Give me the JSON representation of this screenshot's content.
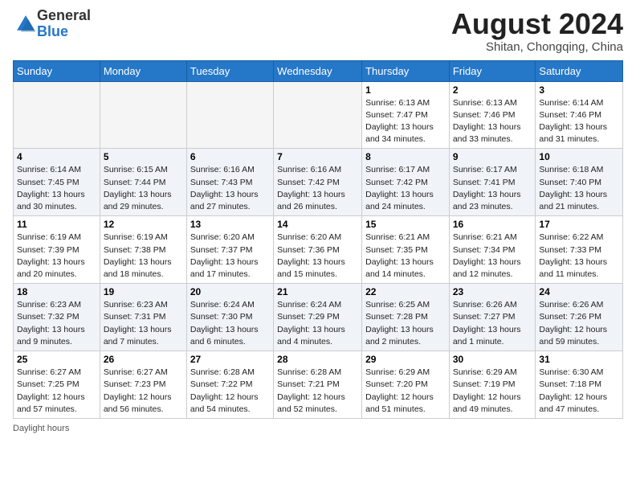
{
  "logo": {
    "general": "General",
    "blue": "Blue"
  },
  "title": "August 2024",
  "location": "Shitan, Chongqing, China",
  "days_of_week": [
    "Sunday",
    "Monday",
    "Tuesday",
    "Wednesday",
    "Thursday",
    "Friday",
    "Saturday"
  ],
  "footer": "Daylight hours",
  "weeks": [
    [
      {
        "day": "",
        "empty": true
      },
      {
        "day": "",
        "empty": true
      },
      {
        "day": "",
        "empty": true
      },
      {
        "day": "",
        "empty": true
      },
      {
        "day": "1",
        "sunrise": "6:13 AM",
        "sunset": "7:47 PM",
        "daylight": "13 hours and 34 minutes."
      },
      {
        "day": "2",
        "sunrise": "6:13 AM",
        "sunset": "7:46 PM",
        "daylight": "13 hours and 33 minutes."
      },
      {
        "day": "3",
        "sunrise": "6:14 AM",
        "sunset": "7:46 PM",
        "daylight": "13 hours and 31 minutes."
      }
    ],
    [
      {
        "day": "4",
        "sunrise": "6:14 AM",
        "sunset": "7:45 PM",
        "daylight": "13 hours and 30 minutes."
      },
      {
        "day": "5",
        "sunrise": "6:15 AM",
        "sunset": "7:44 PM",
        "daylight": "13 hours and 29 minutes."
      },
      {
        "day": "6",
        "sunrise": "6:16 AM",
        "sunset": "7:43 PM",
        "daylight": "13 hours and 27 minutes."
      },
      {
        "day": "7",
        "sunrise": "6:16 AM",
        "sunset": "7:42 PM",
        "daylight": "13 hours and 26 minutes."
      },
      {
        "day": "8",
        "sunrise": "6:17 AM",
        "sunset": "7:42 PM",
        "daylight": "13 hours and 24 minutes."
      },
      {
        "day": "9",
        "sunrise": "6:17 AM",
        "sunset": "7:41 PM",
        "daylight": "13 hours and 23 minutes."
      },
      {
        "day": "10",
        "sunrise": "6:18 AM",
        "sunset": "7:40 PM",
        "daylight": "13 hours and 21 minutes."
      }
    ],
    [
      {
        "day": "11",
        "sunrise": "6:19 AM",
        "sunset": "7:39 PM",
        "daylight": "13 hours and 20 minutes."
      },
      {
        "day": "12",
        "sunrise": "6:19 AM",
        "sunset": "7:38 PM",
        "daylight": "13 hours and 18 minutes."
      },
      {
        "day": "13",
        "sunrise": "6:20 AM",
        "sunset": "7:37 PM",
        "daylight": "13 hours and 17 minutes."
      },
      {
        "day": "14",
        "sunrise": "6:20 AM",
        "sunset": "7:36 PM",
        "daylight": "13 hours and 15 minutes."
      },
      {
        "day": "15",
        "sunrise": "6:21 AM",
        "sunset": "7:35 PM",
        "daylight": "13 hours and 14 minutes."
      },
      {
        "day": "16",
        "sunrise": "6:21 AM",
        "sunset": "7:34 PM",
        "daylight": "13 hours and 12 minutes."
      },
      {
        "day": "17",
        "sunrise": "6:22 AM",
        "sunset": "7:33 PM",
        "daylight": "13 hours and 11 minutes."
      }
    ],
    [
      {
        "day": "18",
        "sunrise": "6:23 AM",
        "sunset": "7:32 PM",
        "daylight": "13 hours and 9 minutes."
      },
      {
        "day": "19",
        "sunrise": "6:23 AM",
        "sunset": "7:31 PM",
        "daylight": "13 hours and 7 minutes."
      },
      {
        "day": "20",
        "sunrise": "6:24 AM",
        "sunset": "7:30 PM",
        "daylight": "13 hours and 6 minutes."
      },
      {
        "day": "21",
        "sunrise": "6:24 AM",
        "sunset": "7:29 PM",
        "daylight": "13 hours and 4 minutes."
      },
      {
        "day": "22",
        "sunrise": "6:25 AM",
        "sunset": "7:28 PM",
        "daylight": "13 hours and 2 minutes."
      },
      {
        "day": "23",
        "sunrise": "6:26 AM",
        "sunset": "7:27 PM",
        "daylight": "13 hours and 1 minute."
      },
      {
        "day": "24",
        "sunrise": "6:26 AM",
        "sunset": "7:26 PM",
        "daylight": "12 hours and 59 minutes."
      }
    ],
    [
      {
        "day": "25",
        "sunrise": "6:27 AM",
        "sunset": "7:25 PM",
        "daylight": "12 hours and 57 minutes."
      },
      {
        "day": "26",
        "sunrise": "6:27 AM",
        "sunset": "7:23 PM",
        "daylight": "12 hours and 56 minutes."
      },
      {
        "day": "27",
        "sunrise": "6:28 AM",
        "sunset": "7:22 PM",
        "daylight": "12 hours and 54 minutes."
      },
      {
        "day": "28",
        "sunrise": "6:28 AM",
        "sunset": "7:21 PM",
        "daylight": "12 hours and 52 minutes."
      },
      {
        "day": "29",
        "sunrise": "6:29 AM",
        "sunset": "7:20 PM",
        "daylight": "12 hours and 51 minutes."
      },
      {
        "day": "30",
        "sunrise": "6:29 AM",
        "sunset": "7:19 PM",
        "daylight": "12 hours and 49 minutes."
      },
      {
        "day": "31",
        "sunrise": "6:30 AM",
        "sunset": "7:18 PM",
        "daylight": "12 hours and 47 minutes."
      }
    ]
  ],
  "row_shades": [
    "row-white",
    "row-shade",
    "row-white",
    "row-shade",
    "row-white"
  ]
}
